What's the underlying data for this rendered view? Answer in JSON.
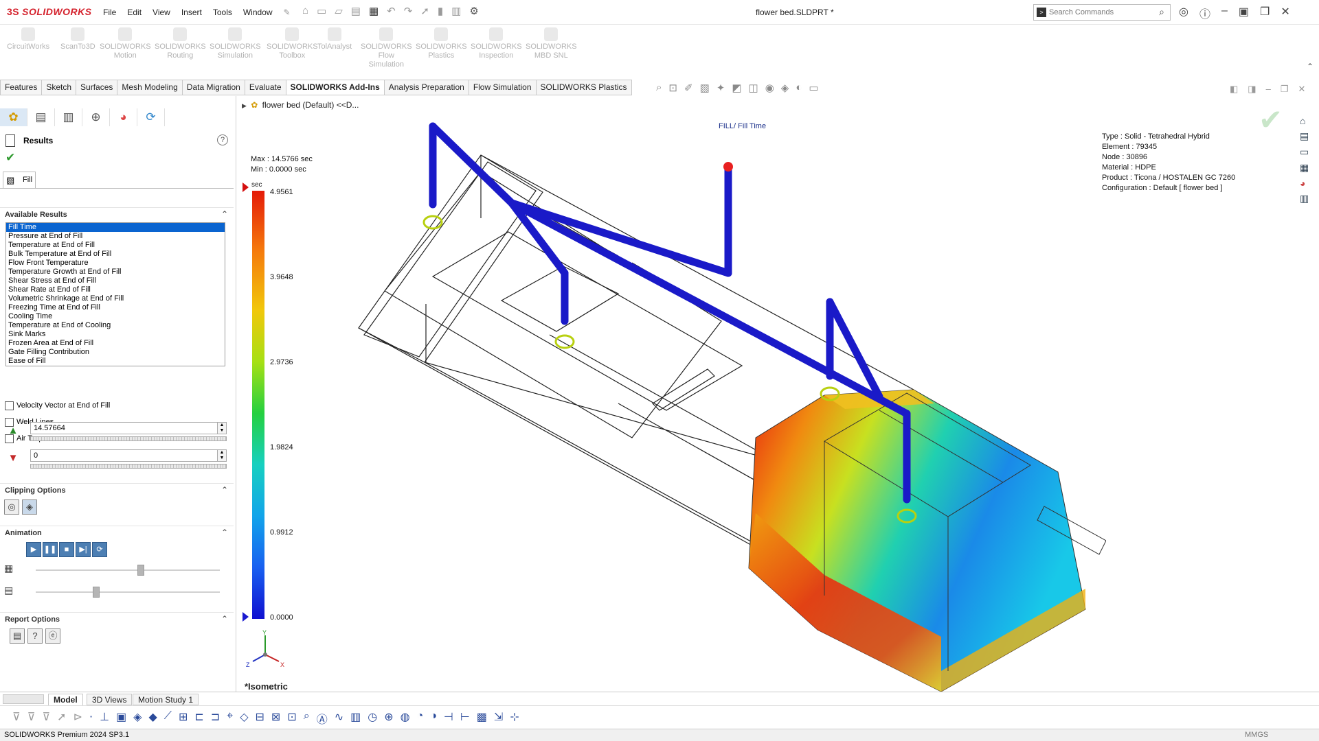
{
  "app": {
    "logo_prefix": "3S",
    "logo_text": "SOLIDWORKS",
    "menus": [
      "File",
      "Edit",
      "View",
      "Insert",
      "Tools",
      "Window"
    ],
    "document_title": "flower bed.SLDPRT *",
    "search_placeholder": "Search Commands"
  },
  "ribbon": {
    "addins": [
      {
        "label": "CircuitWorks"
      },
      {
        "label": "ScanTo3D"
      },
      {
        "label": "SOLIDWORKS\nMotion"
      },
      {
        "label": "SOLIDWORKS\nRouting"
      },
      {
        "label": "SOLIDWORKS\nSimulation"
      },
      {
        "label": "SOLIDWORKS\nToolbox"
      },
      {
        "label": "TolAnalyst"
      },
      {
        "label": "SOLIDWORKS\nFlow\nSimulation"
      },
      {
        "label": "SOLIDWORKS\nPlastics"
      },
      {
        "label": "SOLIDWORKS\nInspection"
      },
      {
        "label": "SOLIDWORKS\nMBD SNL"
      }
    ]
  },
  "tabs": [
    {
      "label": "Features",
      "active": false
    },
    {
      "label": "Sketch",
      "active": false
    },
    {
      "label": "Surfaces",
      "active": false
    },
    {
      "label": "Mesh Modeling",
      "active": false
    },
    {
      "label": "Data Migration",
      "active": false
    },
    {
      "label": "Evaluate",
      "active": false
    },
    {
      "label": "SOLIDWORKS Add-Ins",
      "active": true
    },
    {
      "label": "Analysis Preparation",
      "active": false
    },
    {
      "label": "Flow Simulation",
      "active": false
    },
    {
      "label": "SOLIDWORKS Plastics",
      "active": false
    }
  ],
  "panel": {
    "title": "Results",
    "help": "?",
    "fill_tab": "Fill",
    "available_results_label": "Available Results",
    "results": [
      "Fill Time",
      "Pressure at End of Fill",
      "Temperature at End of Fill",
      "Bulk Temperature at End of Fill",
      "Flow Front Temperature",
      "Temperature Growth at End of Fill",
      "Shear Stress at End of Fill",
      "Shear Rate at End of Fill",
      "Volumetric Shrinkage at End of Fill",
      "Freezing Time at End of Fill",
      "Cooling Time",
      "Temperature at End of Cooling",
      "Sink Marks",
      "Frozen Area at End of Fill",
      "Gate Filling Contribution",
      "Ease of Fill"
    ],
    "selected_result": "Fill Time",
    "checkbox_velocity": "Velocity Vector at End of Fill",
    "checkbox_weld": "Weld Lines",
    "checkbox_air": "Air Traps",
    "max_value": "14.57664",
    "min_value": "0",
    "clipping_label": "Clipping Options",
    "animation_label": "Animation",
    "report_label": "Report Options",
    "anim_speed_fraction": 0.57,
    "anim_frame_fraction": 0.33
  },
  "viewport": {
    "tree_node": "flower bed (Default) <<D...",
    "plot_title": "FILL/ Fill Time",
    "max_line": "Max : 14.5766 sec",
    "min_line": "Min : 0.0000 sec",
    "legend_unit": "sec",
    "legend_values": [
      "4.9561",
      "3.9648",
      "2.9736",
      "1.9824",
      "0.9912",
      "0.0000"
    ],
    "info_lines": [
      "Type : Solid - Tetrahedral Hybrid",
      "Element : 79345",
      "Node : 30896",
      "Material : HDPE",
      "Product : Ticona / HOSTALEN GC 7260",
      "Configuration : Default [ flower bed ]"
    ],
    "view_orientation": "*Isometric",
    "triad_labels": {
      "y": "Y",
      "z": "Z",
      "x": "X"
    }
  },
  "bottom_tabs": [
    {
      "label": "Model",
      "active": true
    },
    {
      "label": "3D Views",
      "active": false
    },
    {
      "label": "Motion Study 1",
      "active": false
    }
  ],
  "status": {
    "product": "SOLIDWORKS Premium 2024 SP3.1",
    "units": "MMGS"
  },
  "colors": {
    "brand": "#d4202b",
    "selection": "#0a64d0",
    "runner": "#1a1ac8"
  }
}
